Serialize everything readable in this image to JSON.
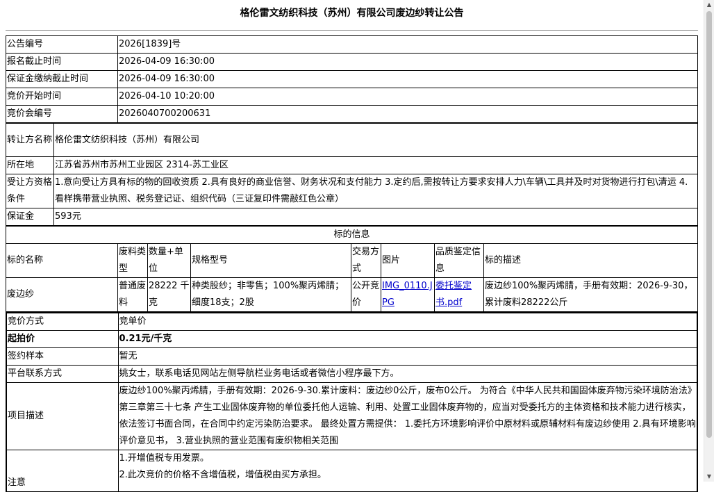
{
  "title": "格伦雷文纺织科技（苏州）有限公司废边纱转让公告",
  "info_rows": [
    {
      "label": "公告编号",
      "value": "2026[1839]号"
    },
    {
      "label": "报名截止时间",
      "value": "2026-04-09 16:30:00"
    },
    {
      "label": "保证金缴纳截止时间",
      "value": "2026-04-09 16:30:00"
    },
    {
      "label": "竞价开始时间",
      "value": "2026-04-10 10:20:00"
    },
    {
      "label": "竞价会编号",
      "value": "2026040700200631"
    }
  ],
  "transferor_rows": [
    {
      "label": "转让方名称",
      "value": "格伦雷文纺织科技（苏州）有限公司"
    },
    {
      "label": "所在地",
      "value": "江苏省苏州市苏州工业园区 2314-苏工业区"
    },
    {
      "label": "受让方资格条件",
      "value": "1.意向受让方具有标的物的回收资质 2.具有良好的商业信誉、财务状况和支付能力 3.定约后,需按转让方要求安排人力\\车辆\\工具并及时对货物进行打包\\清运 4.看样携带营业执照、税务登记证、组织代码（三证复印件需敲红色公章）"
    },
    {
      "label": "保证金",
      "value": "593元"
    }
  ],
  "lot": {
    "section_title": "标的信息",
    "headers": {
      "name": "标的名称",
      "waste_type": "废料类型",
      "quantity": "数量+单位",
      "spec": "规格型号",
      "trade_method": "交易方式",
      "image": "图片",
      "quality_cert": "品质鉴定信息",
      "description": "标的描述"
    },
    "row": {
      "name": "废边纱",
      "waste_type": "普通废料",
      "quantity": "28222 千克",
      "spec": "种类股纱；非零售；100%聚丙烯腈；细度18支；2股",
      "trade_method": "公开竞价",
      "image": "IMG_0110.JPG",
      "quality_cert": "委托鉴定书.pdf",
      "description": "废边纱100%聚丙烯腈，手册有效期：2026-9-30，累计废料28222公斤"
    }
  },
  "bid_rows": [
    {
      "label": "竞价方式",
      "value": "竞单价"
    },
    {
      "label": "起拍价",
      "value": "0.21元/千克"
    },
    {
      "label": "签约样本",
      "value": "暂无"
    },
    {
      "label": "平台联系方式",
      "value": "姚女士，联系电话见网站左侧导航栏业务电话或者微信小程序最下方。"
    },
    {
      "label": "项目描述",
      "value": "废边纱100%聚丙烯腈，手册有效期：2026-9-30.累计废料：废边纱0公斤，废布0公斤。 为符合《中华人民共和国固体废弃物污染环境防治法》第三章第三十七条 产生工业固体废弃物的单位委托他人运输、利用、处置工业固体废弃物的，应当对受委托方的主体资格和技术能力进行核实，依法签订书面合同，在合同中约定污染防治要求。 最终处置方需提供： 1.委托方环境影响评价中原材料或原辅材料有废边纱使用 2.具有环境影响评价意见书， 3.营业执照的营业范围有废织物相关范围"
    }
  ],
  "notes": {
    "label": "注意",
    "lines": [
      "1.开增值税专用发票。",
      "2.此次竞价的价格不含增值税，增值税由买方承担。"
    ]
  }
}
